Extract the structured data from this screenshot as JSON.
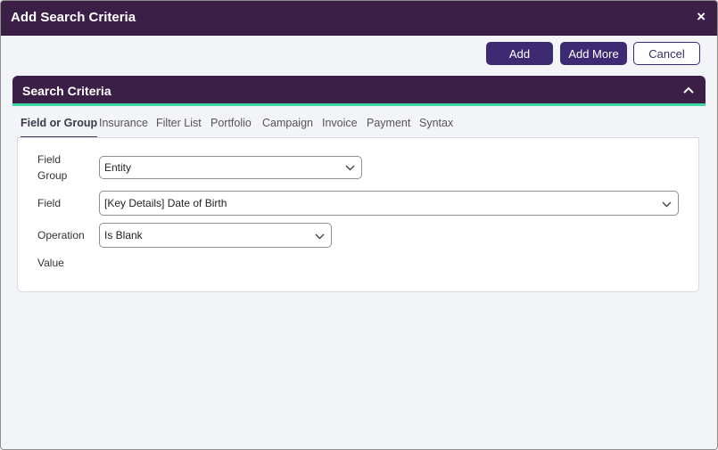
{
  "dialog": {
    "title": "Add Search Criteria",
    "close_label": "×"
  },
  "toolbar": {
    "add_label": "Add",
    "add_more_label": "Add More",
    "cancel_label": "Cancel"
  },
  "section": {
    "title": "Search Criteria",
    "collapse_icon": "chevron-up-icon"
  },
  "tabs": [
    {
      "label": "Field or Group",
      "active": true
    },
    {
      "label": "Insurance"
    },
    {
      "label": "Filter List"
    },
    {
      "label": "Portfolio"
    },
    {
      "label": "Campaign"
    },
    {
      "label": "Invoice"
    },
    {
      "label": "Payment"
    },
    {
      "label": "Syntax"
    }
  ],
  "form": {
    "field_group_label_line1": "Field",
    "field_group_label_line2": "Group",
    "field_group_value": "Entity",
    "field_label": "Field",
    "field_value": "[Key Details] Date of Birth",
    "operation_label": "Operation",
    "operation_value": "Is Blank",
    "value_label": "Value"
  },
  "colors": {
    "header_bg": "#3c1f46",
    "button_primary": "#3e2a73",
    "accent_underline": "#3cd6a2"
  }
}
